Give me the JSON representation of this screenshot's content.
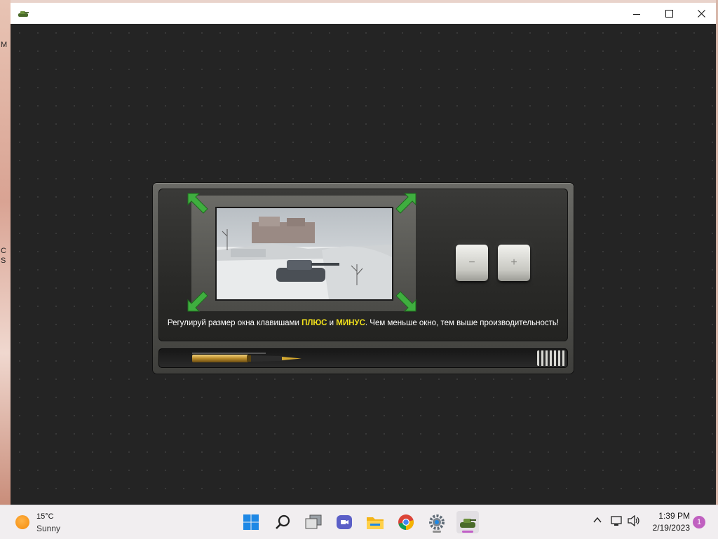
{
  "desktop": {
    "left_texts": [
      "M",
      "C",
      "S"
    ]
  },
  "window": {
    "title": "",
    "controls": {
      "minimize": "minimize",
      "maximize": "maximize",
      "close": "close"
    }
  },
  "launcher": {
    "hint_part1": "Регулируй размер окна клавишами ",
    "hint_plus": "ПЛЮС",
    "hint_and": " и ",
    "hint_minus": "МИНУС",
    "hint_part2": ". Чем меньше окно, тем выше производительность!",
    "minus_key": "−",
    "plus_key": "+",
    "accent_color": "#f2e11c",
    "arrow_color": "#3fae3f"
  },
  "taskbar": {
    "weather": {
      "temp": "15°C",
      "condition": "Sunny"
    },
    "apps": [
      "start-icon",
      "search-icon",
      "task-view-icon",
      "chat-icon",
      "file-explorer-icon",
      "chrome-icon",
      "settings-icon",
      "tank-game-icon"
    ],
    "clock": {
      "time": "1:39 PM",
      "date": "2/19/2023"
    },
    "notifications": "1"
  }
}
